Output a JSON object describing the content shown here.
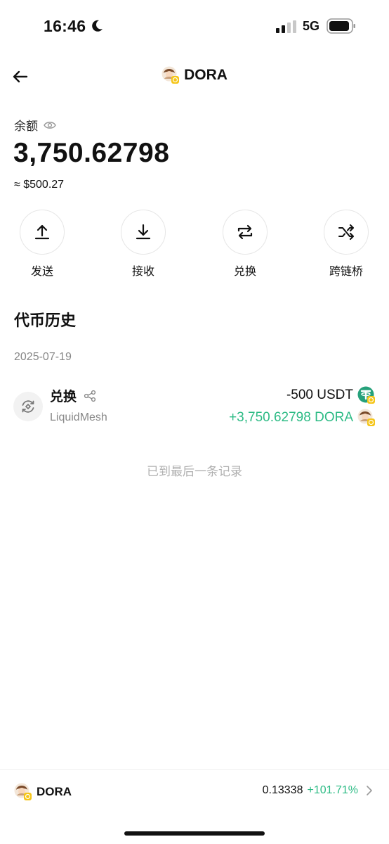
{
  "status_bar": {
    "time": "16:46",
    "network": "5G"
  },
  "header": {
    "title": "DORA",
    "back_icon": "arrow-left-icon"
  },
  "balance": {
    "label": "余额",
    "amount": "3,750.62798",
    "fiat": "≈ $500.27"
  },
  "actions": [
    {
      "label": "发送",
      "icon": "upload-arrow-icon"
    },
    {
      "label": "接收",
      "icon": "download-arrow-icon"
    },
    {
      "label": "兑换",
      "icon": "swap-icon"
    },
    {
      "label": "跨链桥",
      "icon": "shuffle-icon"
    }
  ],
  "history": {
    "title": "代币历史",
    "date": "2025-07-19",
    "transactions": [
      {
        "title": "兑换",
        "source": "LiquidMesh",
        "amount_out": "-500 USDT",
        "amount_in": "+3,750.62798 DORA"
      }
    ],
    "end_text": "已到最后一条记录"
  },
  "bottom_bar": {
    "symbol": "DORA",
    "price": "0.13338",
    "change": "+101.71%"
  },
  "colors": {
    "positive": "#2dbb85",
    "muted": "#888888",
    "usdt": "#26a17b",
    "badge": "#f5c518"
  }
}
